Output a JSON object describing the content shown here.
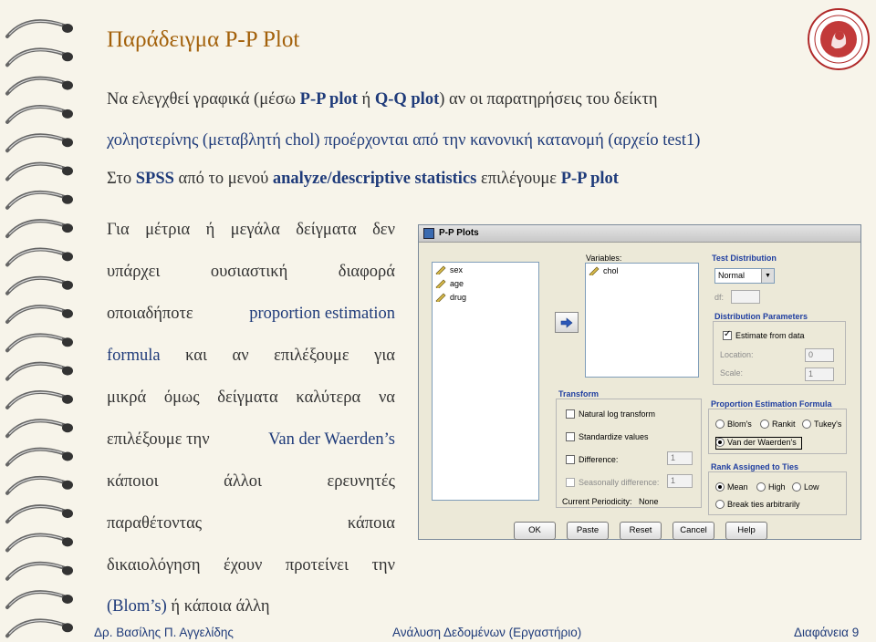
{
  "slide": {
    "title": "Παράδειγμα P-P Plot",
    "intro": {
      "l1a": "Να ελεγχθεί γραφικά (μέσω ",
      "l1b": "P-P plot",
      "l1c": " ή ",
      "l1d": "Q-Q plot",
      "l1e": ") αν οι παρατηρήσεις του δείκτη",
      "l2": "χοληστερίνης (μεταβλητή chol) προέρχονται από την κανονική κατανομή (αρχείο test1)",
      "l3a": "Στο ",
      "l3b": "SPSS",
      "l3c": " από το μενού ",
      "l3d": "analyze/descriptive statistics",
      "l3e": " επιλέγουμε ",
      "l3f": "P-P plot"
    },
    "left_text": {
      "l1": [
        "Για",
        "μέτρια",
        "ή",
        "μεγάλα",
        "δείγματα",
        "δεν"
      ],
      "l2": [
        "υπάρχει",
        "ουσιαστική",
        "διαφορά"
      ],
      "l3a": "οποιαδήποτε",
      "l3b": "proportion estimation",
      "l4a": "formula",
      "l4b": [
        "και",
        "αν",
        "επιλέξουμε",
        "για"
      ],
      "l5": [
        "μικρά",
        "όμως",
        "δείγματα",
        "καλύτερα",
        "να"
      ],
      "l6a": "επιλέξουμε την",
      "l6b": "Van der Waerden’s",
      "l7": [
        "κάποιοι",
        "άλλοι",
        "ερευνητές"
      ],
      "l8": [
        "παραθέτοντας",
        "κάποια"
      ],
      "l9": [
        "δικαιολόγηση",
        "έχουν",
        "προτείνει",
        "την"
      ],
      "l10a": "(Blom’s)",
      "l10b": " ή κάποια άλλη"
    },
    "footer": {
      "author": "Δρ. Βασίλης Π. Αγγελίδης",
      "course": "Ανάλυση Δεδομένων (Εργαστήριο)",
      "page": "Διαφάνεια 9"
    }
  },
  "dialog": {
    "title": "P-P Plots",
    "source_vars": [
      "sex",
      "age",
      "drug"
    ],
    "variables_label": "Variables:",
    "selected_vars": [
      "chol"
    ],
    "test_distribution": {
      "label": "Test Distribution",
      "value": "Normal",
      "df_label": "df:"
    },
    "distribution_parameters": {
      "label": "Distribution Parameters",
      "estimate_label": "Estimate from data",
      "location_label": "Location:",
      "location_value": "0",
      "scale_label": "Scale:",
      "scale_value": "1"
    },
    "transform": {
      "label": "Transform",
      "natural_log": "Natural log transform",
      "standardize": "Standardize values",
      "difference": "Difference:",
      "difference_value": "1",
      "seasonal": "Seasonally difference:",
      "seasonal_value": "1",
      "periodicity_label": "Current Periodicity:",
      "periodicity_value": "None"
    },
    "proportion_formula": {
      "label": "Proportion Estimation Formula",
      "options": [
        "Blom's",
        "Rankit",
        "Tukey's",
        "Van der Waerden's"
      ],
      "selected": "Van der Waerden's"
    },
    "ties": {
      "label": "Rank Assigned to Ties",
      "options": [
        "Mean",
        "High",
        "Low"
      ],
      "break_label": "Break ties arbitrarily"
    },
    "buttons": [
      "OK",
      "Paste",
      "Reset",
      "Cancel",
      "Help"
    ]
  },
  "colors": {
    "title": "#a3610b",
    "highlight": "#1f3b7a",
    "section_header": "#1f3ea0",
    "background": "#f7f4ea"
  }
}
